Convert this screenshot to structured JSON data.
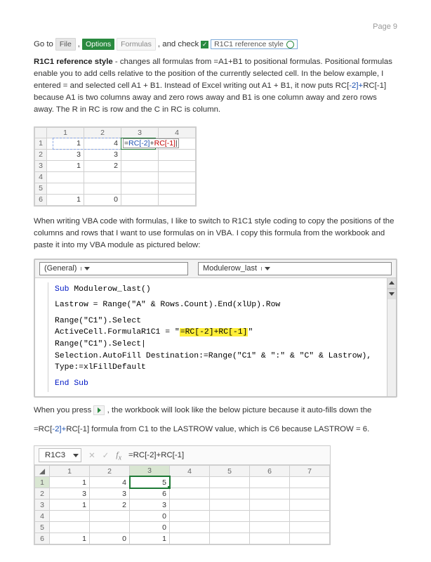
{
  "page_number": "Page 9",
  "intro": {
    "goto": "Go to ",
    "file": "File",
    "options": "Options",
    "formulas": "Formulas",
    "and_check": ", and check",
    "r1c1_box": "R1C1 reference style"
  },
  "para1": {
    "lead_bold": "R1C1 reference style",
    "rest_a": " - changes all formulas from =A1+B1 to positional formulas. Positional formulas enable you to add cells relative to the position of the currently selected cell. In the below example, I entered = and selected cell A1 + B1. Instead of Excel writing out A1 + B1, it now puts RC[",
    "minus2a": "-2]",
    "plus": "+",
    "rc1": "RC[-1] ",
    "rest_b": "because A1 is two columns away and zero rows away and B1 is one column away and zero rows away. The R in RC is row and the C in RC is column."
  },
  "sheet1": {
    "cols": [
      "1",
      "2",
      "3",
      "4"
    ],
    "rows": [
      "1",
      "2",
      "3",
      "4",
      "5",
      "6"
    ],
    "values": {
      "r1c1": "1",
      "r1c2": "4",
      "r2c1": "3",
      "r2c2": "3",
      "r3c1": "1",
      "r3c2": "2",
      "r6c1": "1",
      "r6c2": "0"
    },
    "formula": "=RC[-2]+RC[-1]"
  },
  "para2": "When writing VBA code with formulas, I like to switch to R1C1 style coding to copy the positions of the columns and rows that I want to use formulas on in VBA. I copy this formula from the workbook and paste it into my VBA module as pictured below:",
  "vba": {
    "combo1": "(General)",
    "combo2": "Modulerow_last",
    "l1": "Sub Modulerow_last()",
    "l2": "Lastrow = Range(\"A\" & Rows.Count).End(xlUp).Row",
    "l3": "Range(\"C1\").Select",
    "l4a": "ActiveCell.FormulaR1C1 = \"",
    "l4h": "=RC[-2]+RC[-1]",
    "l4b": "\"",
    "l5": "Range(\"C1\").Select",
    "l6": "Selection.AutoFill Destination:=Range(\"C1\" & \":\" & \"C\" & Lastrow), Type:=xlFillDefault",
    "l7": "End Sub"
  },
  "para3a": "When you press ",
  "para3b": " , the workbook will look like the below picture because it auto-fills down the",
  "para4a": "=RC[",
  "para4b": "-2]",
  "para4c": "+",
  "para4d": "RC[-1] formula from C1 to the LASTROW value, which is C6 because LASTROW = 6.",
  "sheet2": {
    "namebox": "R1C3",
    "fx": "=RC[-2]+RC[-1]",
    "cols": [
      "1",
      "2",
      "3",
      "4",
      "5",
      "6",
      "7"
    ],
    "rows": [
      "1",
      "2",
      "3",
      "4",
      "5",
      "6"
    ],
    "cells": {
      "r1": [
        "1",
        "4",
        "5",
        "",
        "",
        "",
        ""
      ],
      "r2": [
        "3",
        "3",
        "6",
        "",
        "",
        "",
        ""
      ],
      "r3": [
        "1",
        "2",
        "3",
        "",
        "",
        "",
        ""
      ],
      "r4": [
        "",
        "",
        "0",
        "",
        "",
        "",
        ""
      ],
      "r5": [
        "",
        "",
        "0",
        "",
        "",
        "",
        ""
      ],
      "r6": [
        "1",
        "0",
        "1",
        "",
        "",
        "",
        ""
      ]
    }
  }
}
